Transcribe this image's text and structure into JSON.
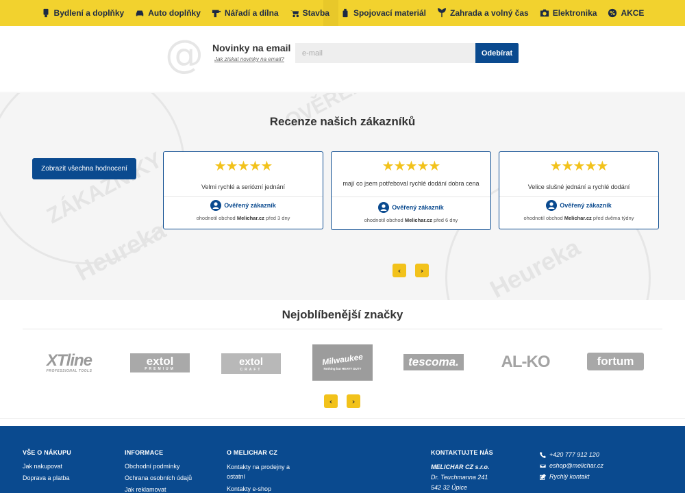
{
  "nav": {
    "items": [
      {
        "label": "Bydlení a doplňky",
        "icon": "plug-icon"
      },
      {
        "label": "Auto doplňky",
        "icon": "car-icon"
      },
      {
        "label": "Nářadí a dílna",
        "icon": "drill-icon"
      },
      {
        "label": "Stavba",
        "icon": "wheelbarrow-icon"
      },
      {
        "label": "Spojovací materiál",
        "icon": "bolt-icon"
      },
      {
        "label": "Zahrada a volný čas",
        "icon": "plant-icon"
      },
      {
        "label": "Elektronika",
        "icon": "camera-icon"
      },
      {
        "label": "AKCE",
        "icon": "percent-badge-icon"
      }
    ]
  },
  "newsletter": {
    "title": "Novinky na email",
    "link": "Jak získat novinky na email?",
    "placeholder": "e-mail",
    "button": "Odebírat"
  },
  "reviews": {
    "title": "Recenze našich zákazníků",
    "show_all": "Zobrazit všechna hodnocení",
    "watermark_top": "OVĚŘENO",
    "watermark_mid": "ZÁKAZNÍKY",
    "watermark_brand": "Heureka",
    "cards": [
      {
        "stars": "★★★★★",
        "text": "Velmi rychlé a seriózní jednání",
        "verified": "Ověřený zákazník",
        "meta_pre": "ohodnotil obchod",
        "shop": "Melichar.cz",
        "when": "před 3 dny"
      },
      {
        "stars": "★★★★★",
        "text": "mají co jsem potřeboval rychlé dodání dobra cena",
        "verified": "Ověřený zákazník",
        "meta_pre": "ohodnotil obchod",
        "shop": "Melichar.cz",
        "when": "před 6 dny"
      },
      {
        "stars": "★★★★★",
        "text": "Velice slušné jednání a rychlé dodání",
        "verified": "Ověřený zákazník",
        "meta_pre": "ohodnotil obchod",
        "shop": "Melichar.cz",
        "when": "před dvěma týdny"
      }
    ],
    "prev": "‹",
    "next": "›"
  },
  "brands": {
    "title": "Nejoblíbenější značky",
    "items": [
      {
        "name": "XTline",
        "sub": "PROFESSIONAL TOOLS"
      },
      {
        "name": "extol",
        "sub": "PREMIUM"
      },
      {
        "name": "extol",
        "sub": "CRAFT"
      },
      {
        "name": "Milwaukee",
        "sub": "Nothing but HEAVY DUTY"
      },
      {
        "name": "tescoma.",
        "sub": ""
      },
      {
        "name": "AL-KO",
        "sub": ""
      },
      {
        "name": "fortum",
        "sub": ""
      }
    ],
    "prev": "‹",
    "next": "›"
  },
  "footer": {
    "col1": {
      "head": "VŠE O NÁKUPU",
      "links": [
        "Jak nakupovat",
        "Doprava a platba"
      ]
    },
    "col2": {
      "head": "INFORMACE",
      "links": [
        "Obchodní podmínky",
        "Ochrana osobních údajů",
        "Jak reklamovat"
      ]
    },
    "col3": {
      "head": "O MELICHAR CZ",
      "links": [
        "Kontakty na prodejny a ostatní",
        "Kontakty e-shop"
      ]
    },
    "col4": {
      "head": "KONTAKTUJTE NÁS",
      "company": "MELICHAR CZ s.r.o.",
      "street": "Dr. Teuchmanna 241",
      "city": "542 32 Úpice"
    },
    "col5": {
      "phone": "+420 777 912 120",
      "email": "eshop@melichar.cz",
      "quick": "Rychlý kontakt"
    }
  },
  "colors": {
    "yellow": "#f2d22e",
    "blue": "#0a4a8f",
    "star": "#f2c21b"
  }
}
